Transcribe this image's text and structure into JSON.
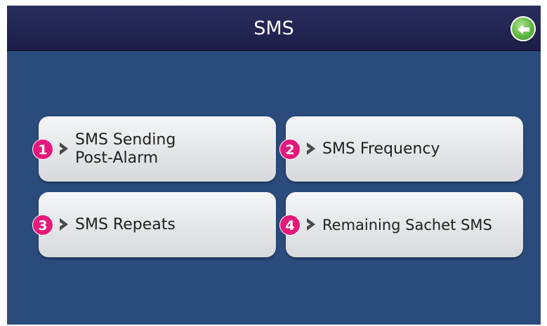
{
  "header": {
    "title": "SMS",
    "back_icon": "back-arrow-icon",
    "back_color": "#5bb43c"
  },
  "colors": {
    "background": "#2a4b7c",
    "header": "#1c1e48",
    "badge": "#e5187c",
    "button": "#e6e7e9"
  },
  "menu": {
    "items": [
      {
        "number": "1",
        "lines": [
          "SMS Sending",
          "Post-Alarm"
        ]
      },
      {
        "number": "2",
        "lines": [
          "SMS Frequency"
        ]
      },
      {
        "number": "3",
        "lines": [
          "SMS Repeats"
        ]
      },
      {
        "number": "4",
        "lines": [
          "Remaining Sachet SMS"
        ]
      }
    ]
  }
}
